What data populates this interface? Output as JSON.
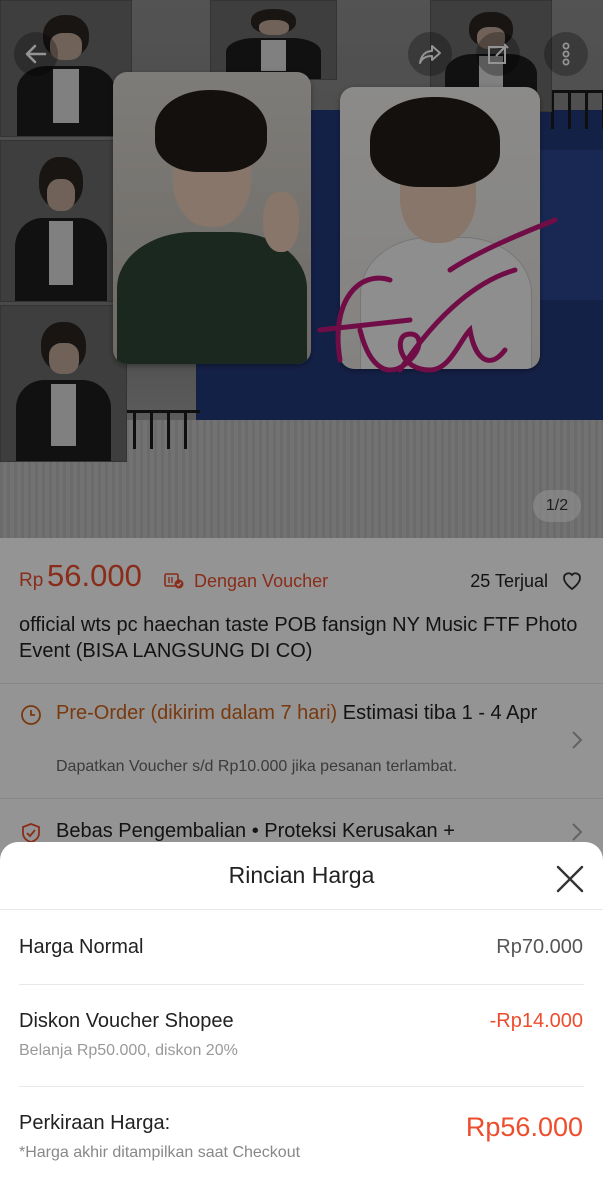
{
  "hero": {
    "pager": "1/2",
    "signature_text": "Free"
  },
  "product": {
    "currency": "Rp",
    "price": "56.000",
    "voucher_label": "Dengan Voucher",
    "sold": "25 Terjual",
    "title": "official wts pc haechan taste POB fansign NY Music FTF Photo Event (BISA LANGSUNG DI CO)",
    "preorder_label": "Pre-Order (dikirim dalam 7 hari)",
    "estimate": " Estimasi tiba 1 - 4 Apr",
    "voucher_note": "Dapatkan Voucher s/d Rp10.000 jika pesanan terlambat.",
    "return_text": "Bebas Pengembalian  •  Proteksi Kerusakan +"
  },
  "sheet": {
    "title": "Rincian Harga",
    "normal_label": "Harga Normal",
    "normal_value": "Rp70.000",
    "discount_label": "Diskon Voucher Shopee",
    "discount_value": "-Rp14.000",
    "discount_sub": "Belanja Rp50.000, diskon 20%",
    "estimate_label": "Perkiraan Harga:",
    "estimate_value": "Rp56.000",
    "estimate_sub": "*Harga akhir ditampilkan saat Checkout"
  },
  "colors": {
    "accent": "#ee4d2d",
    "preorder": "#d0621a"
  },
  "icons": [
    "back-arrow-icon",
    "share-icon",
    "edit-icon",
    "more-icon",
    "voucher-ticket-icon",
    "heart-icon",
    "clock-icon",
    "shield-icon",
    "chevron-right-icon",
    "close-icon"
  ]
}
